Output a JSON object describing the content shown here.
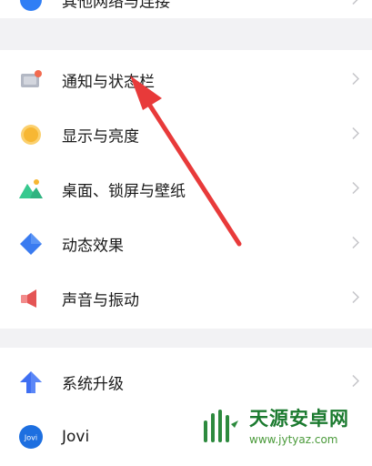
{
  "settings_groups": [
    {
      "items": [
        {
          "label": "其他网络与连接",
          "icon": "link-icon"
        }
      ]
    },
    {
      "items": [
        {
          "label": "通知与状态栏",
          "icon": "notification-icon"
        },
        {
          "label": "显示与亮度",
          "icon": "brightness-icon"
        },
        {
          "label": "桌面、锁屏与壁纸",
          "icon": "wallpaper-icon"
        },
        {
          "label": "动态效果",
          "icon": "dynamic-effects-icon"
        },
        {
          "label": "声音与振动",
          "icon": "sound-icon"
        }
      ]
    },
    {
      "items": [
        {
          "label": "系统升级",
          "icon": "system-update-icon"
        },
        {
          "label": "Jovi",
          "icon": "jovi-icon"
        }
      ]
    }
  ],
  "watermark": {
    "text": "天源安卓网",
    "url": "www.jytyaz.com"
  },
  "colors": {
    "background": "#f2f2f4",
    "card": "#ffffff",
    "arrow": "#e83a3a",
    "watermark": "#1b7a2f"
  }
}
